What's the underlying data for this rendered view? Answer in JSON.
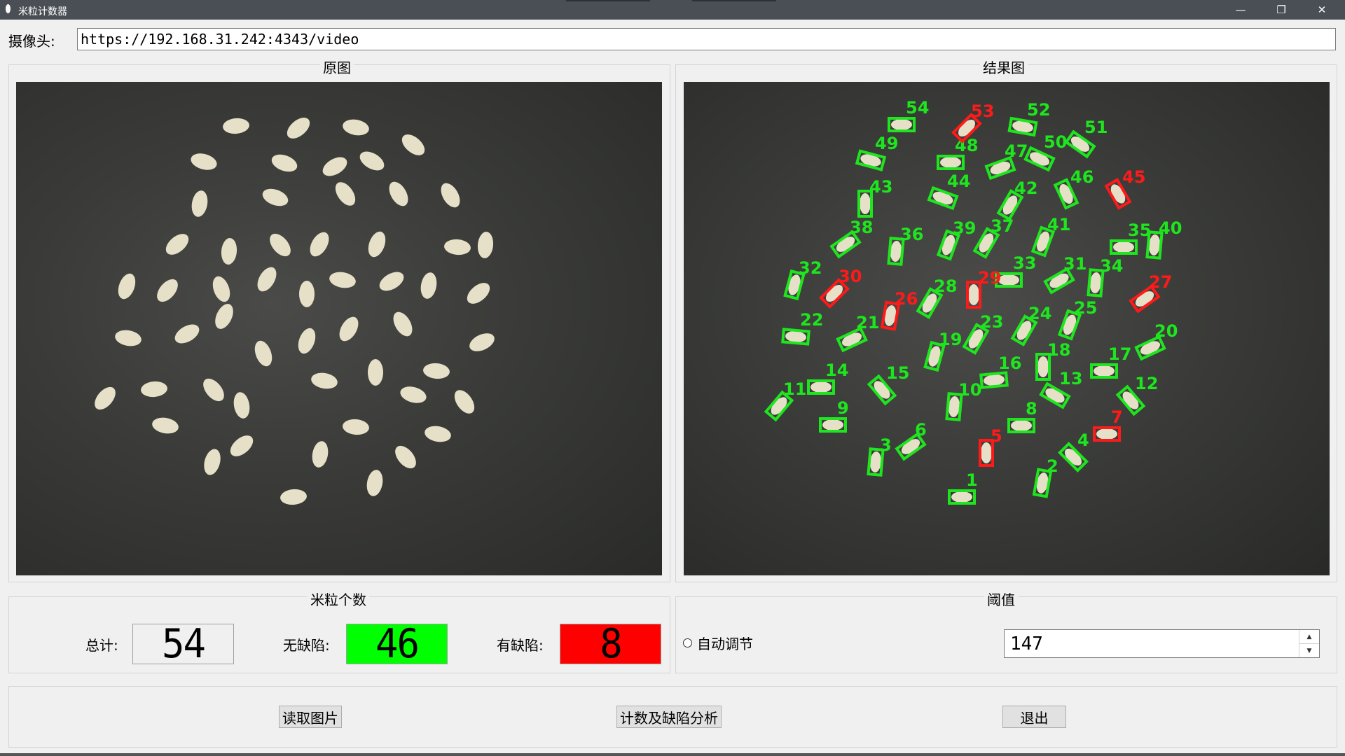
{
  "window": {
    "title": "米粒计数器",
    "min_glyph": "—",
    "max_glyph": "❐",
    "close_glyph": "✕"
  },
  "camera": {
    "label": "摄像头:",
    "url": "https://192.168.31.242:4343/video"
  },
  "panels": {
    "original_title": "原图",
    "result_title": "结果图"
  },
  "counts": {
    "title": "米粒个数",
    "total_label": "总计:",
    "total": "54",
    "good_label": "无缺陷:",
    "good": "46",
    "defect_label": "有缺陷:",
    "defect": "8",
    "colors": {
      "good_bg": "#00ff00",
      "defect_bg": "#ff0000",
      "total_bg": "#f0f0f0"
    }
  },
  "threshold": {
    "title": "阈值",
    "auto_label": "自动调节",
    "auto_checked": false,
    "value": "147"
  },
  "buttons": {
    "read": "读取图片",
    "analyze": "计数及缺陷分析",
    "exit": "退出"
  },
  "result_colors": {
    "good": "#1ee61e",
    "defect": "#ff1a1a"
  },
  "result_labels": {
    "good": [
      "1",
      "2",
      "3",
      "4",
      "6",
      "8",
      "9",
      "10",
      "11",
      "12",
      "13",
      "14",
      "15",
      "16",
      "17",
      "18",
      "19",
      "20",
      "21",
      "22",
      "23",
      "24",
      "25",
      "28",
      "31",
      "32",
      "33",
      "34",
      "35",
      "36",
      "37",
      "38",
      "39",
      "40",
      "41",
      "42",
      "43",
      "44",
      "46",
      "47",
      "48",
      "49",
      "50",
      "51",
      "52",
      "54"
    ],
    "defect": [
      "5",
      "7",
      "26",
      "27",
      "29",
      "30",
      "45",
      "53"
    ]
  }
}
